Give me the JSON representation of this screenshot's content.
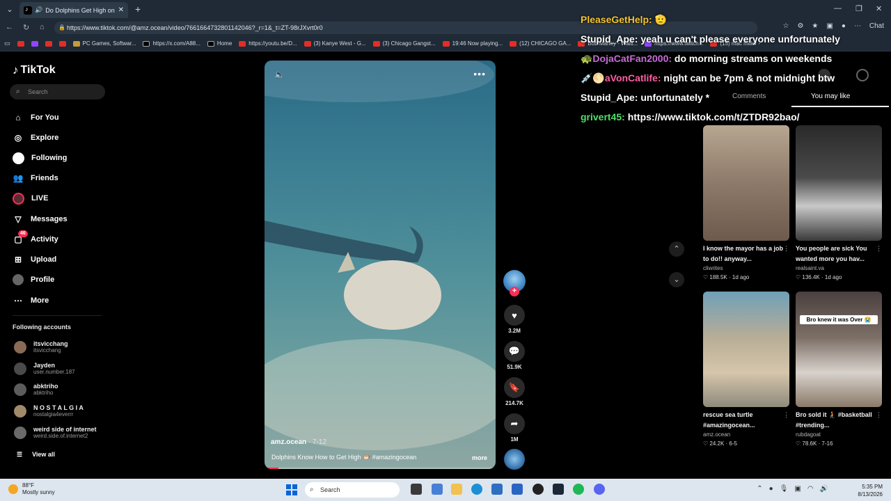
{
  "browser": {
    "tab_title": "Do Dolphins Get High on Puf",
    "url": "https://www.tiktok.com/@amz.ocean/video/7661664732801142046?_r=1&_t=ZT-98rJXvrt0r0",
    "chat_label": "Chat",
    "bookmarks": [
      {
        "label": "",
        "icon": "youtube"
      },
      {
        "label": "",
        "icon": "twitch"
      },
      {
        "label": "",
        "icon": "youtube"
      },
      {
        "label": "",
        "icon": "youtube"
      },
      {
        "label": "PC Games, Softwar...",
        "icon": "pcgames"
      },
      {
        "label": "https://x.com/A88...",
        "icon": "x"
      },
      {
        "label": "Home",
        "icon": "x"
      },
      {
        "label": "https://youtu.be/D...",
        "icon": "youtube"
      },
      {
        "label": "(3) Kanye West - G...",
        "icon": "youtube"
      },
      {
        "label": "(3) Chicago Gangst...",
        "icon": "youtube"
      },
      {
        "label": "19:46 Now playing...",
        "icon": "youtube"
      },
      {
        "label": "(12) CHICAGO GA...",
        "icon": "youtube"
      },
      {
        "label": "Bob Marley - Waiti...",
        "icon": "youtube"
      },
      {
        "label": "https://www.twitch...",
        "icon": "twitch"
      },
      {
        "label": "(15) mac miller -",
        "icon": "youtube"
      }
    ]
  },
  "sidebar": {
    "logo": "TikTok",
    "search_placeholder": "Search",
    "nav": [
      {
        "label": "For You",
        "icon": "home-icon"
      },
      {
        "label": "Explore",
        "icon": "compass-icon"
      },
      {
        "label": "Following",
        "icon": "following-icon"
      },
      {
        "label": "Friends",
        "icon": "friends-icon"
      },
      {
        "label": "LIVE",
        "icon": "live-icon"
      },
      {
        "label": "Messages",
        "icon": "messages-icon"
      },
      {
        "label": "Activity",
        "icon": "activity-icon",
        "badge": "46"
      },
      {
        "label": "Upload",
        "icon": "upload-icon"
      },
      {
        "label": "Profile",
        "icon": "profile-icon"
      },
      {
        "label": "More",
        "icon": "more-icon"
      }
    ],
    "following_title": "Following accounts",
    "accounts": [
      {
        "name": "itsvicchang",
        "handle": "itsvicchang",
        "color": "#8a6a55"
      },
      {
        "name": "Jayden",
        "handle": "user.number.187",
        "color": "#4a4a4a"
      },
      {
        "name": "abktriho",
        "handle": "abktriho",
        "color": "#5c5c5c"
      },
      {
        "name": "N O S T A L G I A",
        "handle": "nostalgia4everrr",
        "color": "#a08a6a"
      },
      {
        "name": "weird side of internet",
        "handle": "weird.side.of.internet2",
        "color": "#6a6a6a"
      }
    ],
    "view_all": "View all"
  },
  "video": {
    "author": "amz.ocean",
    "date": "7-12",
    "caption": "Dolphins Know How to Get High 🐡 #amazingocean",
    "more_label": "more",
    "progress": 0.06
  },
  "actions": {
    "likes": "3.2M",
    "comments": "51.9K",
    "saves": "214.7K",
    "shares": "1M"
  },
  "chat": [
    {
      "user": "PleaseGetHelp:",
      "text": "🫡",
      "color": "#f4c430"
    },
    {
      "user": "Stupid_Ape:",
      "text": "yeah u can't please everyone unfortunately",
      "color": "#ffffff"
    },
    {
      "user": "🐢DojaCatFan2000:",
      "text": "do morning streams on weekends",
      "color": "#c86dd7"
    },
    {
      "user": "💉🌕aVonCatlife:",
      "text": "night can be 7pm & not midnight btw",
      "color": "#ff5fa2"
    },
    {
      "user": "Stupid_Ape:",
      "text": "unfortunately *",
      "color": "#ffffff"
    },
    {
      "user": "grivert45:",
      "text": "https://www.tiktok.com/t/ZTDR92bao/",
      "color": "#4ee06a"
    }
  ],
  "panel": {
    "tabs": [
      "Comments",
      "You may like"
    ],
    "active_tab": 1,
    "recommendations": [
      {
        "title": "I know the mayor has a job to do!! anyway...",
        "user": "cliwrites",
        "likes": "188.5K",
        "ago": "1d ago",
        "thumb": "linear-gradient(180deg,#b7a690 0%,#8d7a6a 50%,#6d5a4d 100%)",
        "overlay": ""
      },
      {
        "title": "You people are sick You wanted more you hav...",
        "user": "realsaint.va",
        "likes": "136.4K",
        "ago": "1d ago",
        "thumb": "linear-gradient(180deg,#2a2a2a 0%,#4a4a4a 45%,#c8c8c8 70%,#3a3a3a 100%)",
        "overlay": ""
      },
      {
        "title": "rescue sea turtle #amazingocean...",
        "user": "amz.ocean",
        "likes": "24.2K",
        "ago": "6-5",
        "thumb": "linear-gradient(180deg,#6fa0b8 0%,#b8ad96 40%,#d5c6ab 70%,#8f8a7c 100%)",
        "overlay": ""
      },
      {
        "title": "Bro sold it 🧎 #basketball #trending...",
        "user": "rubdagoat",
        "likes": "78.6K",
        "ago": "7-16",
        "thumb": "linear-gradient(180deg,#4a4040 0%,#7d6f66 40%,#d8d2cc 70%,#8a7a6a 100%)",
        "overlay": "Bro knew it was Over 😭"
      }
    ]
  },
  "taskbar": {
    "temp": "88°F",
    "weather": "Mostly sunny",
    "search": "Search",
    "time": "5:35 PM",
    "date": "8/13/2026"
  }
}
